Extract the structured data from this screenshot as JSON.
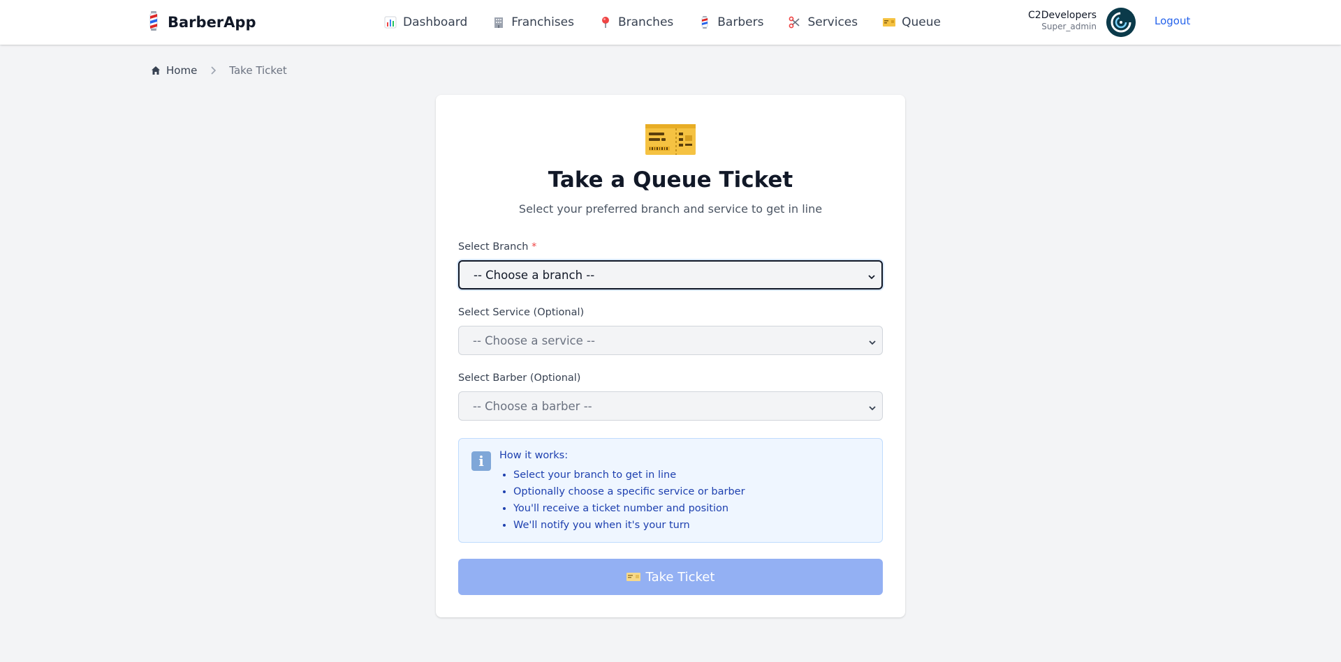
{
  "header": {
    "brand": {
      "name": "BarberApp",
      "icon": "barber-pole-icon"
    },
    "nav": [
      {
        "label": "Dashboard",
        "icon": "bar-chart-icon"
      },
      {
        "label": "Franchises",
        "icon": "office-building-icon"
      },
      {
        "label": "Branches",
        "icon": "map-pin-icon"
      },
      {
        "label": "Barbers",
        "icon": "barber-pole-icon"
      },
      {
        "label": "Services",
        "icon": "scissors-icon"
      },
      {
        "label": "Queue",
        "icon": "ticket-icon"
      }
    ],
    "user": {
      "name": "C2Developers",
      "role": "Super_admin"
    },
    "logout_label": "Logout"
  },
  "breadcrumb": {
    "home_label": "Home",
    "current_label": "Take Ticket"
  },
  "card": {
    "icon": "ticket-icon",
    "title": "Take a Queue Ticket",
    "subtitle": "Select your preferred branch and service to get in line",
    "branch": {
      "label": "Select Branch",
      "required_mark": "*",
      "selected": "-- Choose a branch --"
    },
    "service": {
      "label": "Select Service (Optional)",
      "selected": "-- Choose a service --"
    },
    "barber": {
      "label": "Select Barber (Optional)",
      "selected": "-- Choose a barber --"
    },
    "info": {
      "icon": "info-icon",
      "title": "How it works:",
      "items": [
        "Select your branch to get in line",
        "Optionally choose a specific service or barber",
        "You'll receive a ticket number and position",
        "We'll notify you when it's your turn"
      ]
    },
    "submit_label": "Take Ticket"
  },
  "colors": {
    "accent": "#2563eb",
    "button_disabled": "#93b0f3",
    "info_bg": "#eff6ff",
    "info_text": "#1e40af",
    "required": "#ef4444"
  }
}
